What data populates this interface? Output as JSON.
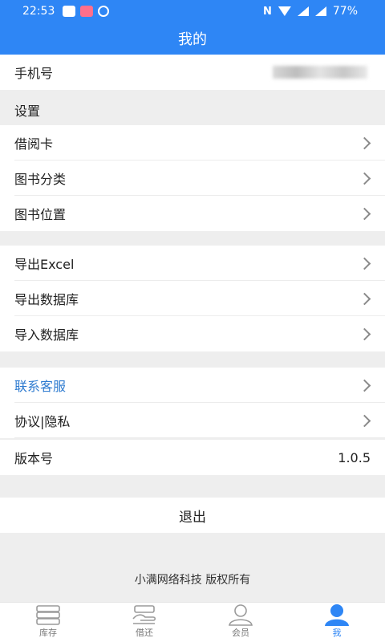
{
  "status_bar": {
    "time": "22:53",
    "battery": "77%",
    "nfc": "N"
  },
  "header": {
    "title": "我的"
  },
  "phone_row": {
    "label": "手机号"
  },
  "settings": {
    "section_label": "设置",
    "items": [
      {
        "label": "借阅卡"
      },
      {
        "label": "图书分类"
      },
      {
        "label": "图书位置"
      }
    ]
  },
  "data_section": {
    "items": [
      {
        "label": "导出Excel"
      },
      {
        "label": "导出数据库"
      },
      {
        "label": "导入数据库"
      }
    ]
  },
  "support_section": {
    "items": [
      {
        "label": "联系客服"
      },
      {
        "label": "协议|隐私"
      }
    ],
    "version": {
      "label": "版本号",
      "value": "1.0.5"
    }
  },
  "logout": {
    "label": "退出"
  },
  "footer": {
    "copyright": "小满网络科技 版权所有"
  },
  "tabbar": {
    "tabs": [
      {
        "label": "库存",
        "icon": "inventory-icon"
      },
      {
        "label": "借还",
        "icon": "borrow-return-icon"
      },
      {
        "label": "会员",
        "icon": "member-icon"
      },
      {
        "label": "我",
        "icon": "me-icon"
      }
    ],
    "active_index": 3
  },
  "colors": {
    "primary": "#2e86f5",
    "link": "#2e7bd0",
    "background": "#eeeeee"
  }
}
